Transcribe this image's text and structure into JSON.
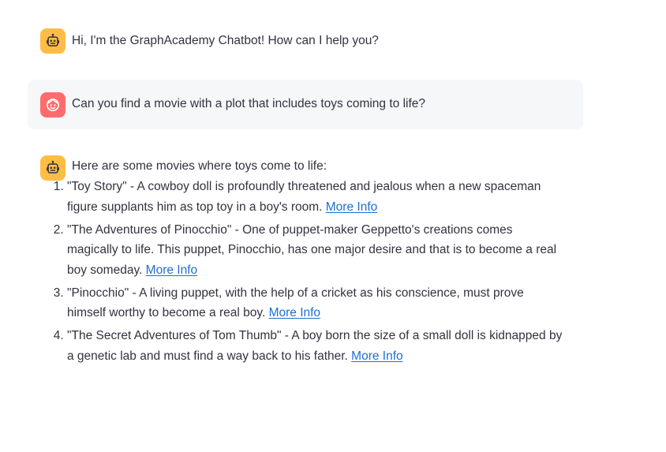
{
  "colors": {
    "bot_avatar": "#ffbd45",
    "user_avatar": "#ff6c6c",
    "user_bubble": "#f6f7f9",
    "text": "#31333f",
    "link": "#1c6fd1"
  },
  "messages": [
    {
      "role": "assistant",
      "icon": "robot-icon",
      "text": "Hi, I'm the GraphAcademy Chatbot! How can I help you?"
    },
    {
      "role": "user",
      "icon": "smiley-face-icon",
      "text": "Can you find a movie with a plot that includes toys coming to life?"
    },
    {
      "role": "assistant",
      "icon": "robot-icon",
      "text": "Here are some movies where toys come to life:",
      "list": [
        {
          "text": "\"Toy Story\" - A cowboy doll is profoundly threatened and jealous when a new spaceman figure supplants him as top toy in a boy's room. ",
          "link": "More Info"
        },
        {
          "text": "\"The Adventures of Pinocchio\" - One of puppet-maker Geppetto's creations comes magically to life. This puppet, Pinocchio, has one major desire and that is to become a real boy someday. ",
          "link": "More Info"
        },
        {
          "text": "\"Pinocchio\" - A living puppet, with the help of a cricket as his conscience, must prove himself worthy to become a real boy. ",
          "link": "More Info"
        },
        {
          "text": "\"The Secret Adventures of Tom Thumb\" - A boy born the size of a small doll is kidnapped by a genetic lab and must find a way back to his father. ",
          "link": "More Info"
        }
      ]
    }
  ]
}
